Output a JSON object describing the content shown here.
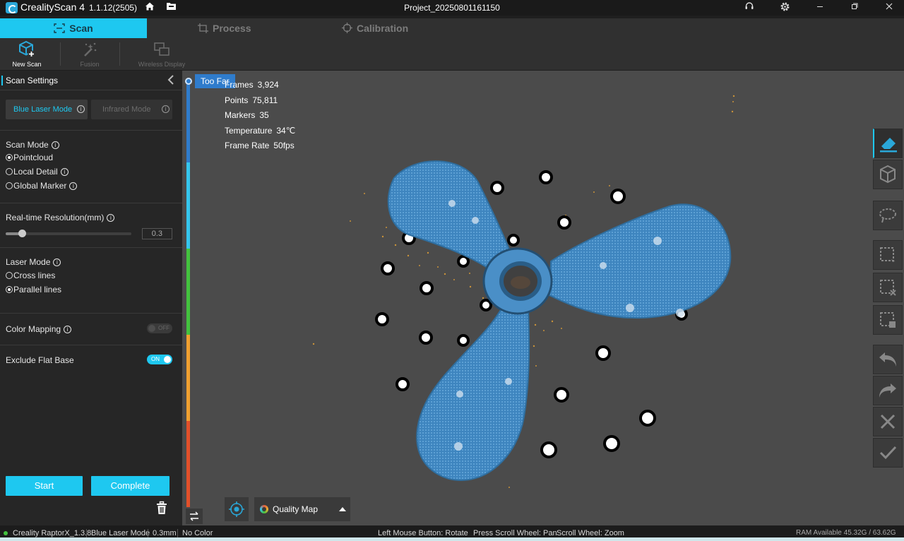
{
  "titlebar": {
    "app_name": "CrealityScan 4",
    "version": "1.1.12(2505)",
    "project": "Project_20250801161150"
  },
  "mode_tabs": [
    {
      "label": "Scan",
      "active": true
    },
    {
      "label": "Process",
      "active": false
    },
    {
      "label": "Calibration",
      "active": false
    }
  ],
  "toolbar": {
    "new_scan": "New Scan",
    "fusion": "Fusion",
    "wireless_display": "Wireless Display"
  },
  "scan_settings": {
    "title": "Scan Settings",
    "blue_laser_mode": "Blue Laser Mode",
    "infrared_mode": "Infrared Mode",
    "scan_mode_label": "Scan Mode",
    "scan_modes": [
      "Pointcloud",
      "Local Detail",
      "Global Marker"
    ],
    "scan_mode_selected": "Pointcloud",
    "resolution_label": "Real-time Resolution(mm)",
    "resolution_value": "0.3",
    "resolution_fraction": 0.13,
    "laser_mode_label": "Laser Mode",
    "laser_modes": [
      "Cross lines",
      "Parallel lines"
    ],
    "laser_mode_selected": "Parallel lines",
    "color_mapping_label": "Color Mapping",
    "color_mapping_state": "OFF",
    "exclude_flat_base_label": "Exclude Flat Base",
    "exclude_flat_base_state": "ON",
    "start_label": "Start",
    "complete_label": "Complete"
  },
  "viewport": {
    "distance_indicator": "Too Far",
    "stats": [
      {
        "label": "Frames",
        "value": "3,924"
      },
      {
        "label": "Points",
        "value": "75,811"
      },
      {
        "label": "Markers",
        "value": "35"
      },
      {
        "label": "Temperature",
        "value": "34℃"
      },
      {
        "label": "Frame Rate",
        "value": "50fps"
      }
    ],
    "quality_map_label": "Quality Map",
    "colors": {
      "model": "#3d82bb",
      "background": "#4b4b4b",
      "accent": "#1ec8f0"
    }
  },
  "statusbar": {
    "device": "Creality RaptorX_1.3.8",
    "laser_mode": "Blue Laser Mode",
    "resolution": "0.3mm",
    "color": "No Color",
    "hint_rotate": "Left Mouse Button: Rotate",
    "hint_pan": "Press Scroll Wheel: Pan",
    "hint_zoom": "Scroll Wheel: Zoom",
    "ram": "RAM Available 45.32G / 63.62G"
  }
}
